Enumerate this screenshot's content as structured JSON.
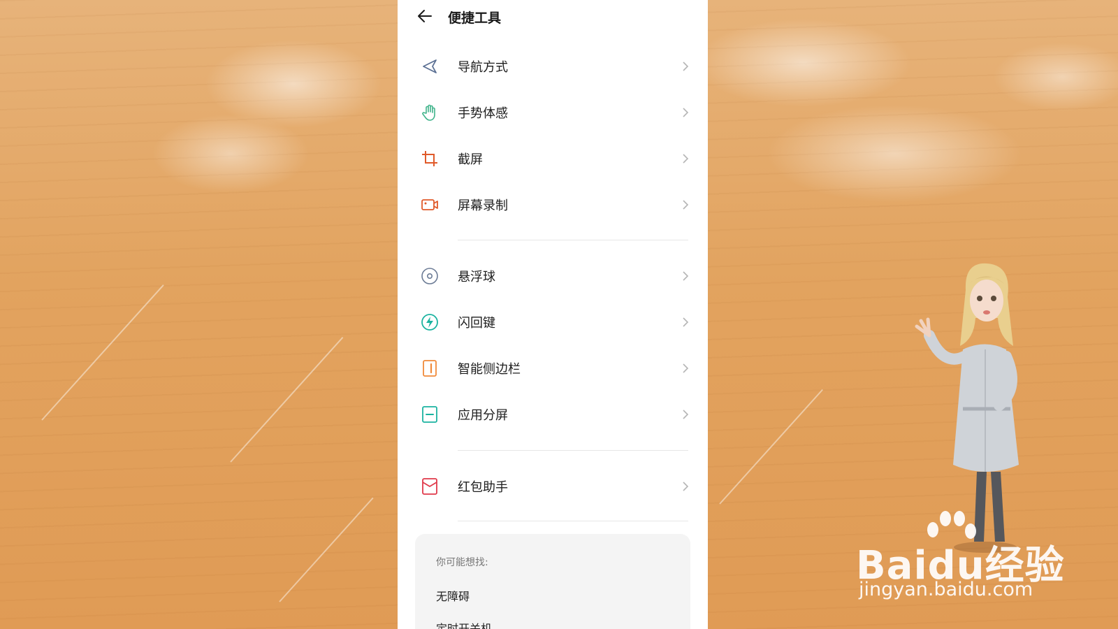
{
  "header": {
    "back_icon": "arrow-left-icon",
    "title": "便捷工具"
  },
  "menu": {
    "groups": [
      [
        {
          "label": "导航方式",
          "icon": "navigation-arrow-icon"
        },
        {
          "label": "手势体感",
          "icon": "hand-gesture-icon"
        },
        {
          "label": "截屏",
          "icon": "crop-screenshot-icon"
        },
        {
          "label": "屏幕录制",
          "icon": "screen-record-icon"
        }
      ],
      [
        {
          "label": "悬浮球",
          "icon": "floating-ball-icon"
        },
        {
          "label": "闪回键",
          "icon": "flashback-key-icon"
        },
        {
          "label": "智能侧边栏",
          "icon": "smart-sidebar-icon"
        },
        {
          "label": "应用分屏",
          "icon": "split-screen-icon"
        }
      ],
      [
        {
          "label": "红包助手",
          "icon": "red-envelope-icon"
        }
      ]
    ]
  },
  "suggestions": {
    "title": "你可能想找:",
    "items": [
      "无障碍",
      "定时开关机"
    ]
  },
  "watermark": {
    "brand_text": "Baidu经验",
    "url": "jingyan.baidu.com"
  },
  "colors": {
    "nav_icon": "#5a6f93",
    "gesture_icon": "#3fb38a",
    "screenshot_icon": "#e05a2a",
    "record_icon": "#e05a2a",
    "float_icon": "#6b7b95",
    "flash_icon": "#1bb3a0",
    "sidebar_icon": "#f08a3a",
    "split_icon": "#1bb3a0",
    "red_envelope_icon": "#e0394a"
  }
}
